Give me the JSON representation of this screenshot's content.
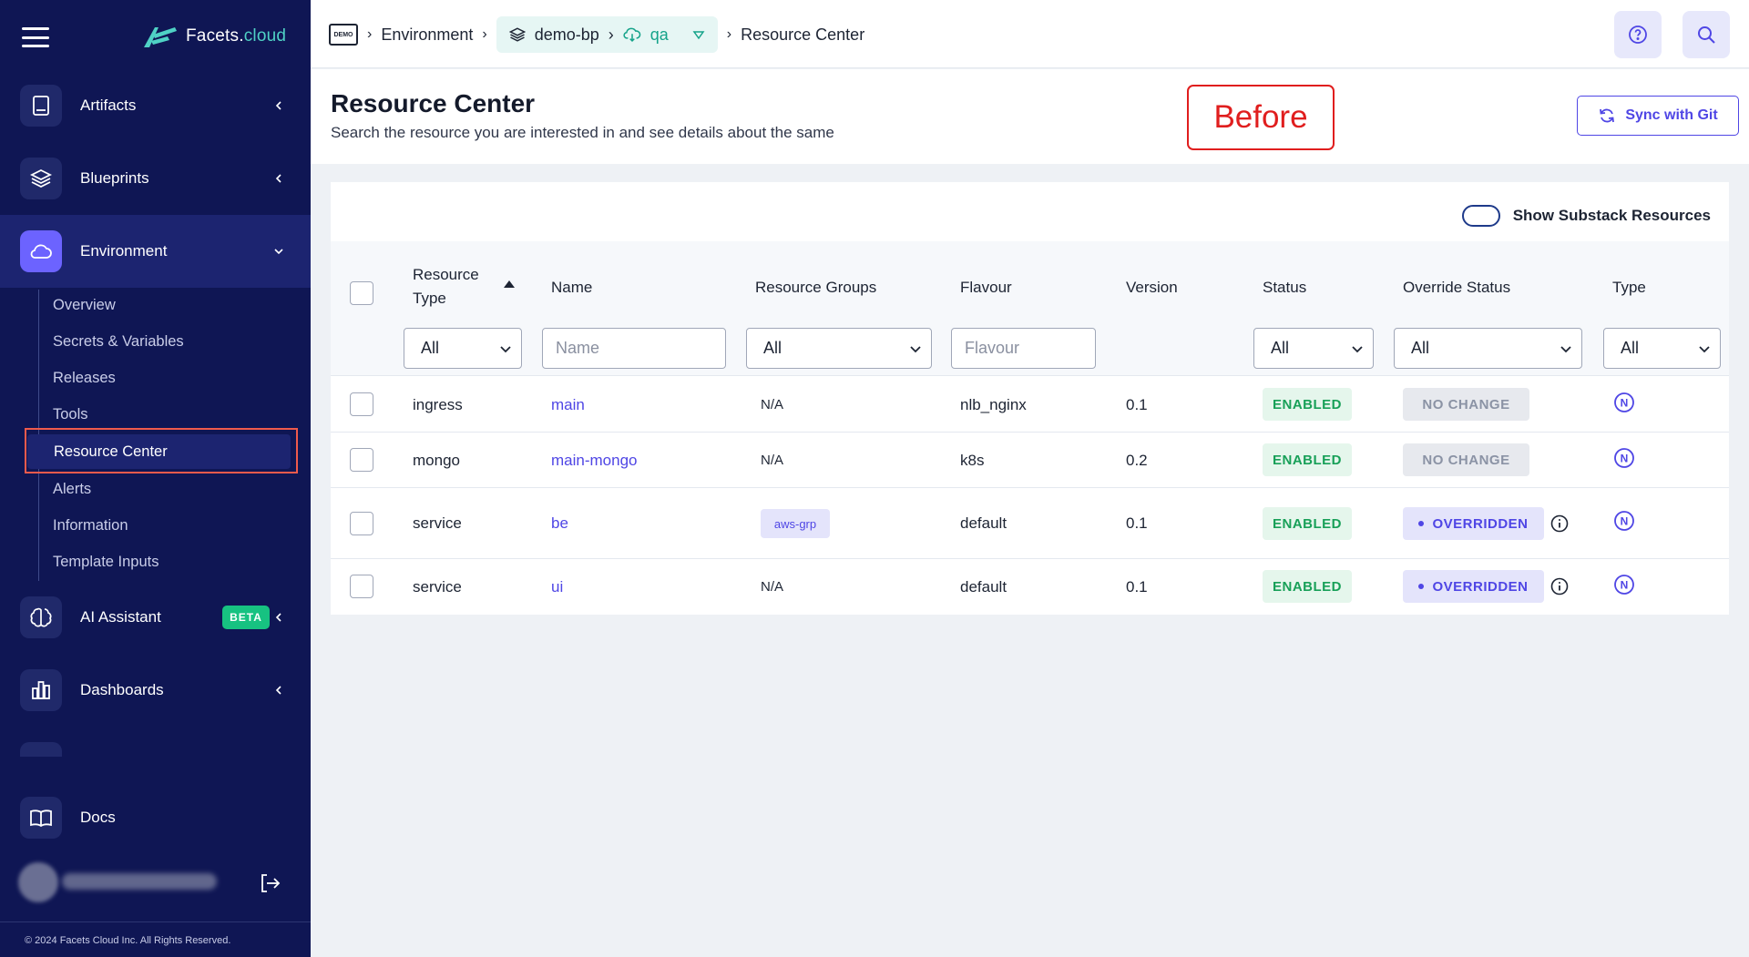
{
  "sidebar": {
    "logo": {
      "part1": "Facets",
      "dot": ".",
      "part2": "cloud"
    },
    "nav": [
      {
        "label": "Artifacts"
      },
      {
        "label": "Blueprints"
      },
      {
        "label": "Environment"
      },
      {
        "label": "AI Assistant",
        "badge": "BETA"
      },
      {
        "label": "Dashboards"
      },
      {
        "label": "Docs"
      }
    ],
    "sub_items": [
      "Overview",
      "Secrets & Variables",
      "Releases",
      "Tools",
      "Resource Center",
      "Alerts",
      "Information",
      "Template Inputs"
    ],
    "footer": "© 2024 Facets Cloud Inc. All Rights Reserved."
  },
  "topbar": {
    "badge_icon": "DEMO",
    "crumbs": [
      "Environment",
      "demo-bp",
      "qa",
      "Resource Center"
    ]
  },
  "page": {
    "title": "Resource Center",
    "subtitle": "Search the resource you are interested in and see details about the same",
    "annotation": "Before",
    "sync_label": "Sync with Git"
  },
  "table": {
    "toggle_label": "Show Substack Resources",
    "headers": {
      "resource_type_1": "Resource",
      "resource_type_2": "Type",
      "name": "Name",
      "resource_groups": "Resource Groups",
      "flavour": "Flavour",
      "version": "Version",
      "status": "Status",
      "override_status": "Override Status",
      "type": "Type"
    },
    "filters": {
      "resource_type": "All",
      "name_placeholder": "Name",
      "resource_groups": "All",
      "flavour_placeholder": "Flavour",
      "status": "All",
      "override_status": "All",
      "type": "All"
    },
    "rows": [
      {
        "resource_type": "ingress",
        "name": "main",
        "group": "N/A",
        "flavour": "nlb_nginx",
        "version": "0.1",
        "status": "ENABLED",
        "override": "NO CHANGE",
        "type_icon": "N"
      },
      {
        "resource_type": "mongo",
        "name": "main-mongo",
        "group": "N/A",
        "flavour": "k8s",
        "version": "0.2",
        "status": "ENABLED",
        "override": "NO CHANGE",
        "type_icon": "N"
      },
      {
        "resource_type": "service",
        "name": "be",
        "group": "aws-grp",
        "flavour": "default",
        "version": "0.1",
        "status": "ENABLED",
        "override": "OVERRIDDEN",
        "type_icon": "N"
      },
      {
        "resource_type": "service",
        "name": "ui",
        "group": "N/A",
        "flavour": "default",
        "version": "0.1",
        "status": "ENABLED",
        "override": "OVERRIDDEN",
        "type_icon": "N"
      }
    ]
  },
  "colors": {
    "sidebar": "#0f1654",
    "accent": "#4f46e5",
    "enabled": "#18a058",
    "annotation": "#e01e1e",
    "highlight_frame": "#ef5a4c"
  },
  "icons": [
    "menu-icon",
    "book-icon",
    "layers-icon",
    "cloud-icon",
    "brain-icon",
    "bar-chart-icon",
    "open-book-icon",
    "logout-icon",
    "help-icon",
    "search-icon",
    "sync-icon",
    "info-icon"
  ]
}
